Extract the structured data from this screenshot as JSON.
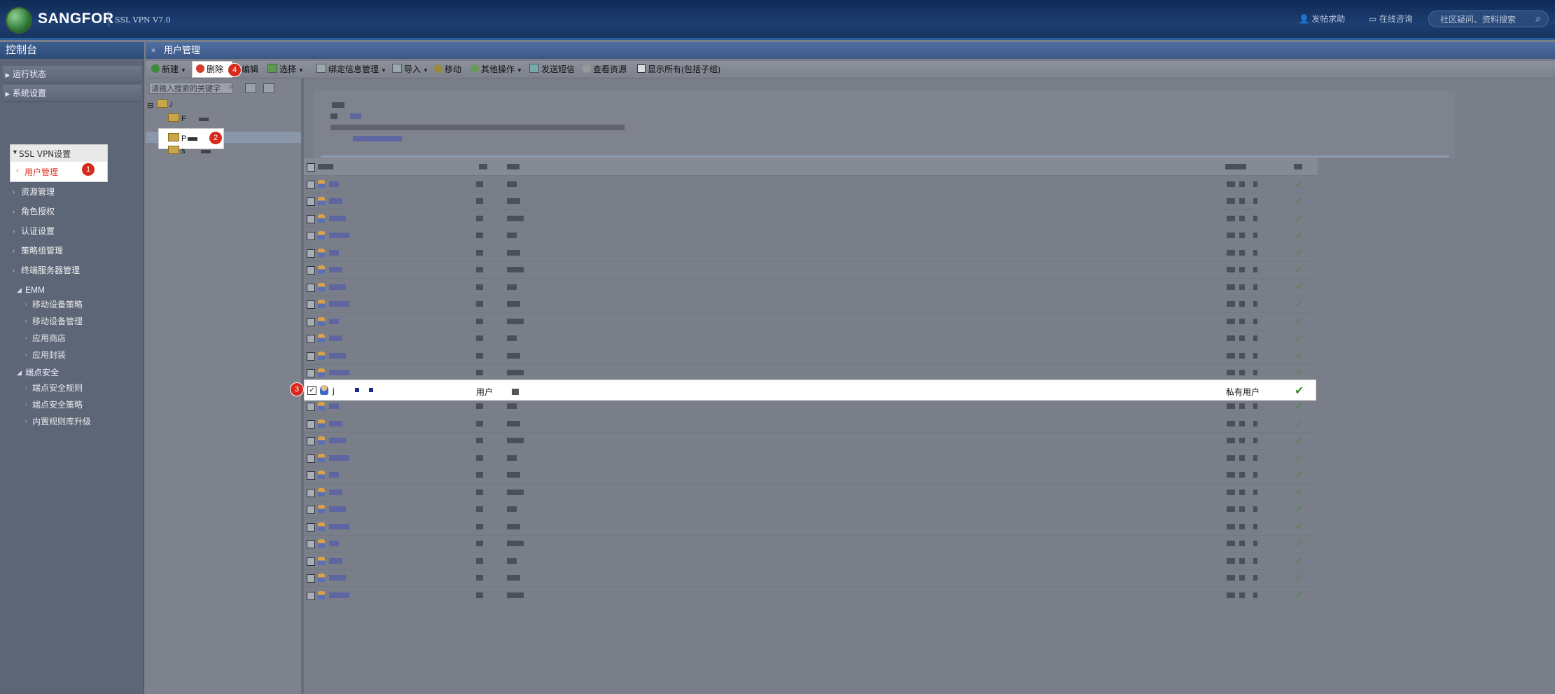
{
  "header": {
    "brand": "SANGFOR",
    "version": "SSL VPN V7.0",
    "links": [
      "发帖求助",
      "在线咨询"
    ],
    "search_placeholder": "社区疑问、资料搜索"
  },
  "sidebar": {
    "title": "控制台",
    "top_items": [
      "运行状态",
      "系统设置",
      "SSL VPN设置"
    ],
    "sub_items": [
      "用户管理",
      "资源管理",
      "角色授权",
      "认证设置",
      "策略组管理",
      "终端服务器管理"
    ],
    "groups": [
      {
        "label": "EMM",
        "items": [
          "移动设备策略",
          "移动设备管理",
          "应用商店",
          "应用封装"
        ]
      },
      {
        "label": "端点安全",
        "items": [
          "端点安全规则",
          "端点安全策略",
          "内置规则库升级"
        ]
      }
    ]
  },
  "main": {
    "title": "用户管理",
    "toolbar": [
      "新建",
      "删除",
      "编辑",
      "选择",
      "绑定信息管理",
      "导入",
      "移动",
      "其他操作",
      "发送短信",
      "查看资源",
      "显示所有(包括子组)"
    ],
    "tree": {
      "search_placeholder": "请输入搜索的关键字",
      "root": "/",
      "nodes": [
        "F",
        "P",
        "s"
      ]
    },
    "selected_row": {
      "name": "j",
      "type": "用户",
      "role": "私有用户",
      "status_icon": "check-icon"
    }
  },
  "badges": [
    "1",
    "2",
    "3",
    "4"
  ],
  "colors": {
    "accent_red": "#d9281c",
    "check_green": "#4a8a3a",
    "header_blue": "#1d3e72"
  }
}
